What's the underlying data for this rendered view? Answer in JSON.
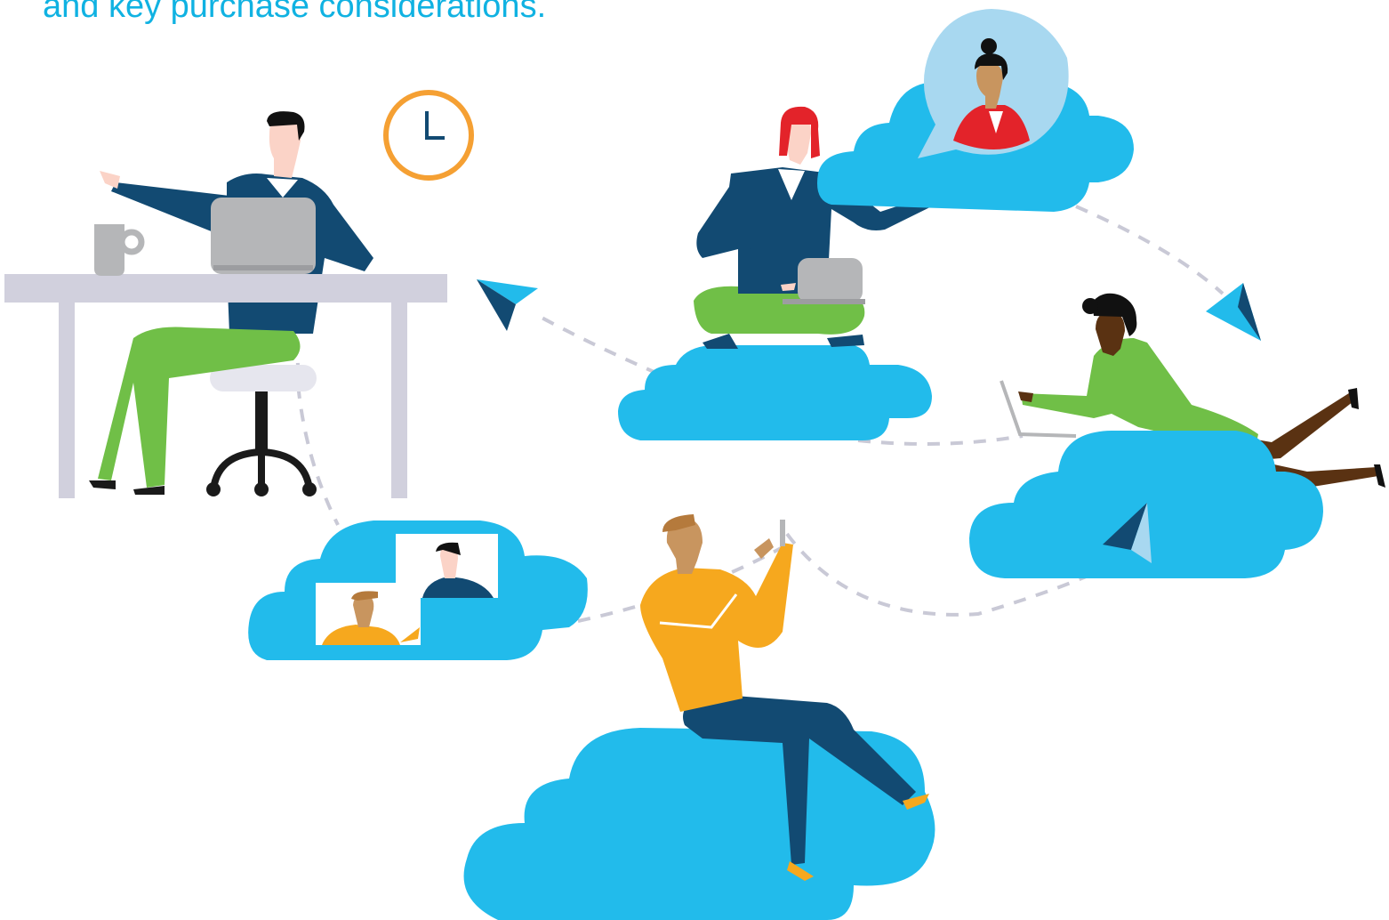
{
  "caption": {
    "text": "and key purchase considerations."
  },
  "colors": {
    "caption": "#10b2e2",
    "cloud": "#22bbeb",
    "navy": "#124a72",
    "green": "#70bf47",
    "orange": "#f6a81e",
    "clock_ring": "#f5a033",
    "red": "#e3232a",
    "desk": "#d1d0dd",
    "laptop": "#b5b6b8",
    "path": "#c9c9d6"
  },
  "illustration": {
    "scenes": [
      "person-at-desk-with-laptop",
      "person-on-cloud-with-laptop",
      "person-in-speech-bubble",
      "person-lying-on-cloud-with-laptop",
      "person-sitting-on-cloud-with-phone",
      "video-call-cloud"
    ],
    "icons": [
      "clock-icon",
      "coffee-mug-icon",
      "paper-plane-icon"
    ]
  }
}
